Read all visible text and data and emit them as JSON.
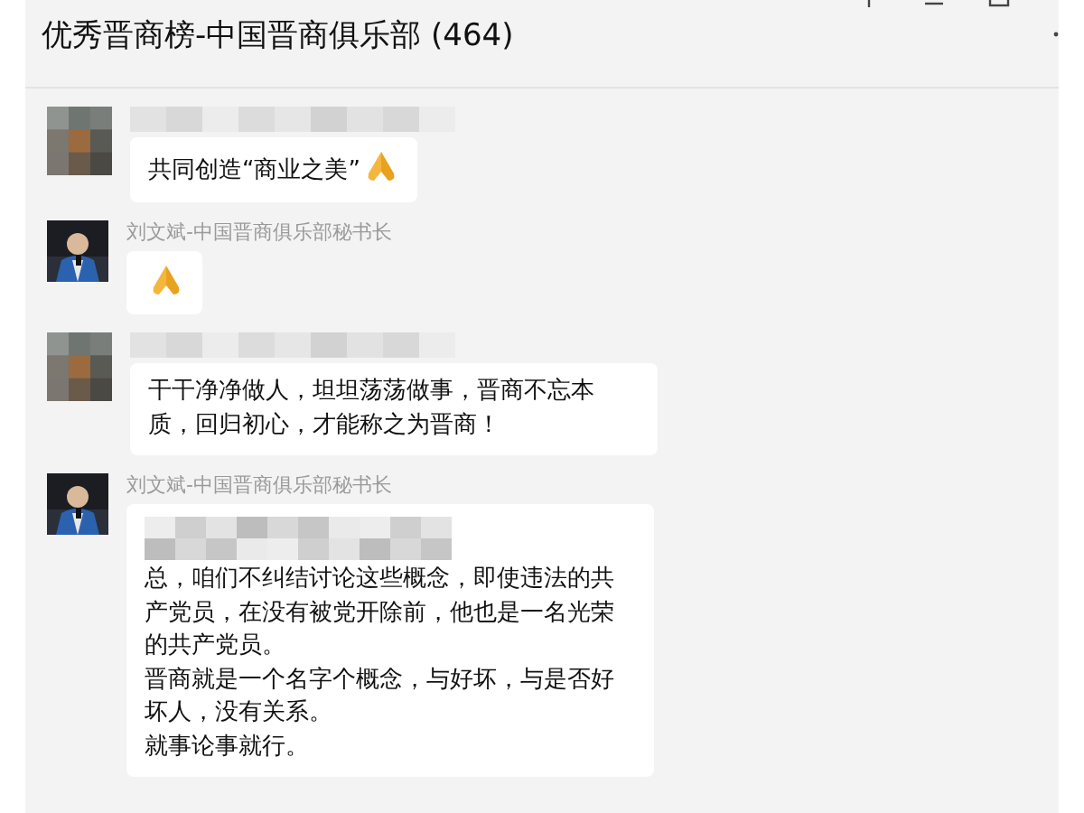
{
  "window": {
    "title": "优秀晋商榜-中国晋商俱乐部 (464)",
    "controls": [
      {
        "kind": "pin"
      },
      {
        "kind": "minimize"
      },
      {
        "kind": "maximize"
      },
      {
        "kind": "more"
      }
    ]
  },
  "messages": [
    {
      "sender": {
        "kind": "blurred"
      },
      "paragraphs": [
        "共同创造“商业之美”"
      ],
      "emoji": true
    },
    {
      "sender": {
        "kind": "named",
        "name": "刘文斌-中国晋商俱乐部秘书长"
      },
      "emoji": true
    },
    {
      "sender": {
        "kind": "blurred"
      },
      "paragraphs": [
        "干干净净做人，坦坦荡荡做事，晋商不忘本质，回归初心，才能称之为晋商！"
      ],
      "emoji": false
    },
    {
      "sender": {
        "kind": "named",
        "name": "刘文斌-中国晋商俱乐部秘书长"
      },
      "quote_blurred": true,
      "paragraphs": [
        "总，咱们不纠结讨论这些概念，即使违法的共产党员，在没有被党开除前，他也是一名光荣的共产党员。",
        "晋商就是一个名字个概念，与好坏，与是否好坏人，没有关系。",
        "就事论事就行。"
      ],
      "emoji": false
    }
  ]
}
